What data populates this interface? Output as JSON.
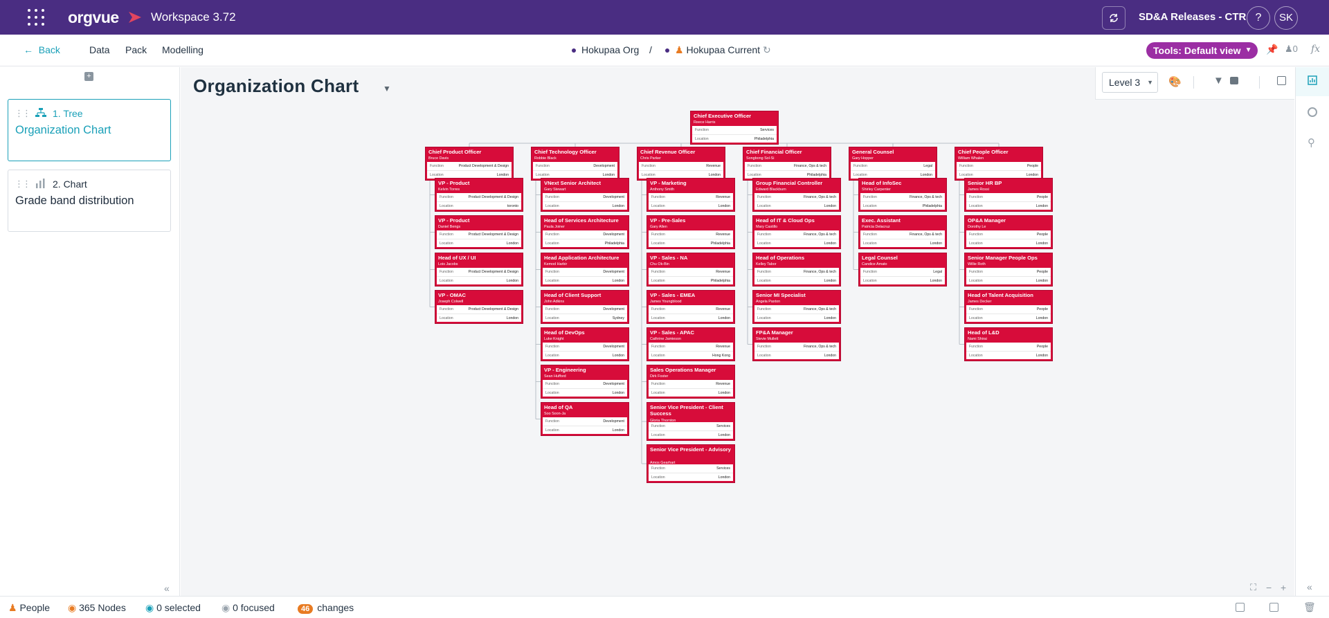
{
  "topbar": {
    "brand": "orgvue",
    "workspace": "Workspace  3.72",
    "release": "SD&A Releases - CTR",
    "help": "?",
    "avatar": "SK"
  },
  "subbar": {
    "back": "Back",
    "nav": [
      "Data",
      "Pack",
      "Modelling"
    ],
    "crumb1": "Hokupaa Org",
    "separator": "/",
    "crumb2": "Hokupaa Current",
    "tools": "Tools: Default view",
    "count": "0",
    "fx": "fx"
  },
  "sidebar": {
    "items": [
      {
        "num": "1. Tree",
        "title": "Organization Chart"
      },
      {
        "num": "2. Chart",
        "title": "Grade band distribution"
      }
    ]
  },
  "canvas": {
    "title": "Organization Chart",
    "level": "Level 3"
  },
  "labels": {
    "function": "Function",
    "location": "Location"
  },
  "ceo": {
    "title": "Chief Executive Officer",
    "name": "Reece Harris",
    "function": "Services",
    "location": "Philadelphia"
  },
  "columns": [
    {
      "head": {
        "title": "Chief Product Officer",
        "name": "Bruce Davis",
        "function": "Product Development & Design",
        "location": "London"
      },
      "reports": [
        {
          "title": "VP - Product",
          "name": "Kelvin Torres",
          "function": "Product Development & Design",
          "location": "toronto"
        },
        {
          "title": "VP - Product",
          "name": "Daniel Bengs",
          "function": "Product Development & Design",
          "location": "London"
        },
        {
          "title": "Head of UX / UI",
          "name": "Lois Jacobs",
          "function": "Product Development & Design",
          "location": "London"
        },
        {
          "title": "VP - OMAC",
          "name": "Joseph Colwell",
          "function": "Product Development & Design",
          "location": "London"
        }
      ]
    },
    {
      "head": {
        "title": "Chief Technology Officer",
        "name": "Robbie Black",
        "function": "Development",
        "location": "London"
      },
      "reports": [
        {
          "title": "VNext Senior Architect",
          "name": "Gary Stewart",
          "function": "Development",
          "location": "London"
        },
        {
          "title": "Head of Services Architecture",
          "name": "Paula Joiner",
          "function": "Development",
          "location": "Philadelphia"
        },
        {
          "title": "Head Application Architecture",
          "name": "Kemod Harbir",
          "function": "Development",
          "location": "London"
        },
        {
          "title": "Head of Client Support",
          "name": "John Adkins",
          "function": "Development",
          "location": "Sydney"
        },
        {
          "title": "Head of DevOps",
          "name": "Luke Knight",
          "function": "Development",
          "location": "London"
        },
        {
          "title": "VP - Engineering",
          "name": "Sean Hufford",
          "function": "Development",
          "location": "London"
        },
        {
          "title": "Head of QA",
          "name": "Soo Soon-Ja",
          "function": "Development",
          "location": "London"
        }
      ]
    },
    {
      "head": {
        "title": "Chief Revenue Officer",
        "name": "Chris Parker",
        "function": "Revenue",
        "location": "London"
      },
      "reports": [
        {
          "title": "VP - Marketing",
          "name": "Anthony Smith",
          "function": "Revenue",
          "location": "London"
        },
        {
          "title": "VP - Pre-Sales",
          "name": "Gary Allen",
          "function": "Revenue",
          "location": "Philadelphia"
        },
        {
          "title": "VP - Sales - NA",
          "name": "Chu Ok-Bin",
          "function": "Revenue",
          "location": "Philadelphia"
        },
        {
          "title": "VP - Sales - EMEA",
          "name": "James Youngblood",
          "function": "Revenue",
          "location": "London"
        },
        {
          "title": "VP - Sales - APAC",
          "name": "Cathrine Jamieson",
          "function": "Revenue",
          "location": "Hong Kong"
        },
        {
          "title": "Sales Operations Manager",
          "name": "Dirk Foster",
          "function": "Revenue",
          "location": "London"
        },
        {
          "title": "Senior Vice President  - Client Success",
          "name": "Gloria Thornton",
          "function": "Services",
          "location": "London"
        },
        {
          "title": "Senior Vice President - Advisory",
          "name": "Amos Gearhart",
          "function": "Services",
          "location": "London"
        }
      ]
    },
    {
      "head": {
        "title": "Chief Financial Officer",
        "name": "Songbong Sol-Si",
        "function": "Finance, Ops & tech",
        "location": "Philadelphia"
      },
      "reports": [
        {
          "title": "Group Financial Controller",
          "name": "Edward Blackburn",
          "function": "Finance, Ops & tech",
          "location": "London"
        },
        {
          "title": "Head of IT & Cloud Ops",
          "name": "Mary Castillo",
          "function": "Finance, Ops & tech",
          "location": "London"
        },
        {
          "title": "Head of Operations",
          "name": "Kelley Tabor",
          "function": "Finance, Ops & tech",
          "location": "London"
        },
        {
          "title": "Senior MI Specialist",
          "name": "Angela Paxton",
          "function": "Finance, Ops & tech",
          "location": "London"
        },
        {
          "title": "FP&A Manager",
          "name": "Stevie Mullett",
          "function": "Finance, Ops & tech",
          "location": "London"
        }
      ]
    },
    {
      "head": {
        "title": "General Counsel",
        "name": "Gary Hopper",
        "function": "Legal",
        "location": "London"
      },
      "reports": [
        {
          "title": "Head of InfoSec",
          "name": "Shirley Carpenter",
          "function": "Finance, Ops & tech",
          "location": "Philadelphia"
        },
        {
          "title": "Exec. Assistant",
          "name": "Patricia Delacruz",
          "function": "Finance, Ops & tech",
          "location": "London"
        },
        {
          "title": "Legal Counsel",
          "name": "Candice Amato",
          "function": "Legal",
          "location": "London"
        }
      ]
    },
    {
      "head": {
        "title": "Chief People Officer",
        "name": "William Whalen",
        "function": "People",
        "location": "London"
      },
      "reports": [
        {
          "title": "Senior HR BP",
          "name": "James Rossi",
          "function": "People",
          "location": "London"
        },
        {
          "title": "OP&A Manager",
          "name": "Dorothy Le",
          "function": "People",
          "location": "London"
        },
        {
          "title": "Senior Manager People Ops",
          "name": "Willie Roth",
          "function": "People",
          "location": "London"
        },
        {
          "title": "Head of Talent Acquisition",
          "name": "James Decker",
          "function": "People",
          "location": "London"
        },
        {
          "title": "Head of L&D",
          "name": "Nami Shirai",
          "function": "People",
          "location": "London"
        }
      ]
    }
  ],
  "status": {
    "people": "People",
    "nodes": "365 Nodes",
    "selected": "0 selected",
    "focused": "0 focused",
    "changes_count": "46",
    "changes": "changes"
  },
  "colors": {
    "brand": "#4a2d82",
    "accent": "#1aa0b8",
    "node": "#d70c3a",
    "tools": "#9b2ea3",
    "badge": "#e87b22"
  }
}
